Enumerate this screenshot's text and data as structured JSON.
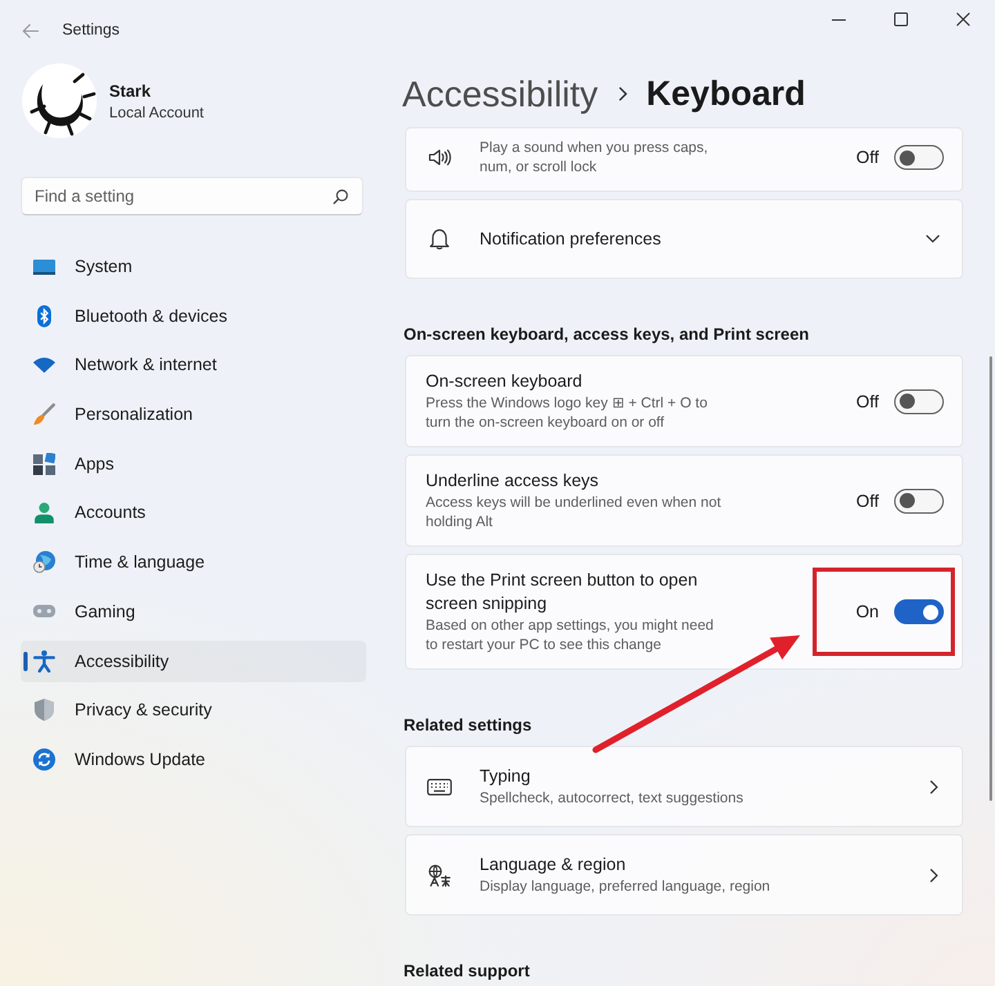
{
  "window": {
    "title": "Settings"
  },
  "account": {
    "name": "Stark",
    "type": "Local Account"
  },
  "search": {
    "placeholder": "Find a setting"
  },
  "sidebar": {
    "items": [
      {
        "label": "System",
        "selected": false
      },
      {
        "label": "Bluetooth & devices",
        "selected": false
      },
      {
        "label": "Network & internet",
        "selected": false
      },
      {
        "label": "Personalization",
        "selected": false
      },
      {
        "label": "Apps",
        "selected": false
      },
      {
        "label": "Accounts",
        "selected": false
      },
      {
        "label": "Time & language",
        "selected": false
      },
      {
        "label": "Gaming",
        "selected": false
      },
      {
        "label": "Accessibility",
        "selected": true
      },
      {
        "label": "Privacy & security",
        "selected": false
      },
      {
        "label": "Windows Update",
        "selected": false
      }
    ]
  },
  "breadcrumb": {
    "parent": "Accessibility",
    "current": "Keyboard"
  },
  "sections": [
    {
      "items": [
        {
          "kind": "toggle",
          "description": "Play a sound when you press caps, num, or scroll lock",
          "state_label": "Off",
          "on": false,
          "highlighted": false
        },
        {
          "kind": "expander",
          "title": "Notification preferences",
          "expanded": false
        }
      ]
    },
    {
      "heading": "On-screen keyboard, access keys, and Print screen",
      "items": [
        {
          "kind": "toggle",
          "title": "On-screen keyboard",
          "description": "Press the Windows logo key ⊞ + Ctrl + O to turn the on-screen keyboard on or off",
          "state_label": "Off",
          "on": false,
          "highlighted": false
        },
        {
          "kind": "toggle",
          "title": "Underline access keys",
          "description": "Access keys will be underlined even when not holding Alt",
          "state_label": "Off",
          "on": false,
          "highlighted": false
        },
        {
          "kind": "toggle",
          "title": "Use the Print screen button to open screen snipping",
          "description": "Based on other app settings, you might need to restart your PC to see this change",
          "state_label": "On",
          "on": true,
          "highlighted": true
        }
      ]
    },
    {
      "heading": "Related settings",
      "items": [
        {
          "kind": "link",
          "title": "Typing",
          "description": "Spellcheck, autocorrect, text suggestions"
        },
        {
          "kind": "link",
          "title": "Language & region",
          "description": "Display language, preferred language, region"
        }
      ]
    },
    {
      "heading": "Related support"
    }
  ]
}
